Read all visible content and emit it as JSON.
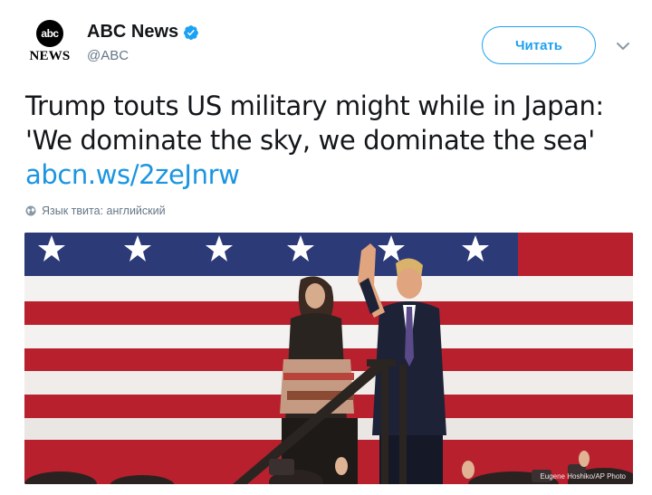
{
  "account": {
    "avatar_top": "abc",
    "avatar_bottom": "NEWS",
    "display_name": "ABC News",
    "handle": "@ABC",
    "verified_icon": "verified-badge-icon"
  },
  "follow_button": {
    "label": "Читать"
  },
  "menu_icon": "chevron-down-icon",
  "tweet": {
    "line1": "Trump touts US military might while in Japan:",
    "line2": "'We dominate the sky, we dominate the sea'",
    "link": "abcn.ws/2zeJnrw"
  },
  "language_note": {
    "icon": "globe-icon",
    "text": "Язык твита: английский"
  },
  "media": {
    "photo_credit": "Eugene Hoshiko/AP Photo"
  },
  "colors": {
    "accent": "#1da1f2",
    "link": "#1b95e0",
    "muted": "#657786",
    "flag_red": "#b22234",
    "flag_blue": "#2c3a78"
  }
}
